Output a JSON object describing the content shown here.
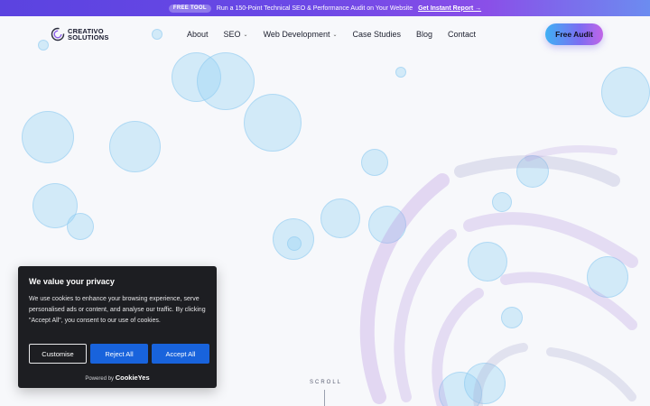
{
  "promo": {
    "badge": "FREE TOOL",
    "text": "Run a 150-Point Technical SEO & Performance Audit on Your Website",
    "link": "Get Instant Report →"
  },
  "logo": {
    "line1": "CREATIVO",
    "line2": "SOLUTIONS",
    "icon": "c-logo-icon"
  },
  "nav": [
    {
      "label": "About",
      "dropdown": false
    },
    {
      "label": "SEO",
      "dropdown": true
    },
    {
      "label": "Web Development",
      "dropdown": true
    },
    {
      "label": "Case Studies",
      "dropdown": false
    },
    {
      "label": "Blog",
      "dropdown": false
    },
    {
      "label": "Contact",
      "dropdown": false
    }
  ],
  "cta_label": "Free Audit",
  "scroll_label": "SCROLL",
  "cookie": {
    "title": "We value your privacy",
    "text": "We use cookies to enhance your browsing experience, serve personalised ads or content, and analyse our traffic. By clicking \"Accept All\", you consent to our use of cookies.",
    "customise": "Customise",
    "reject": "Reject All",
    "accept": "Accept All",
    "powered_by": "Powered by",
    "brand": "CookieYes"
  },
  "colors": {
    "promo_start": "#5b43e0",
    "cta_start": "#3fb0f4",
    "cta_end": "#c165e7",
    "cookie_bg": "#1d1e22",
    "button_blue": "#1863dc"
  }
}
